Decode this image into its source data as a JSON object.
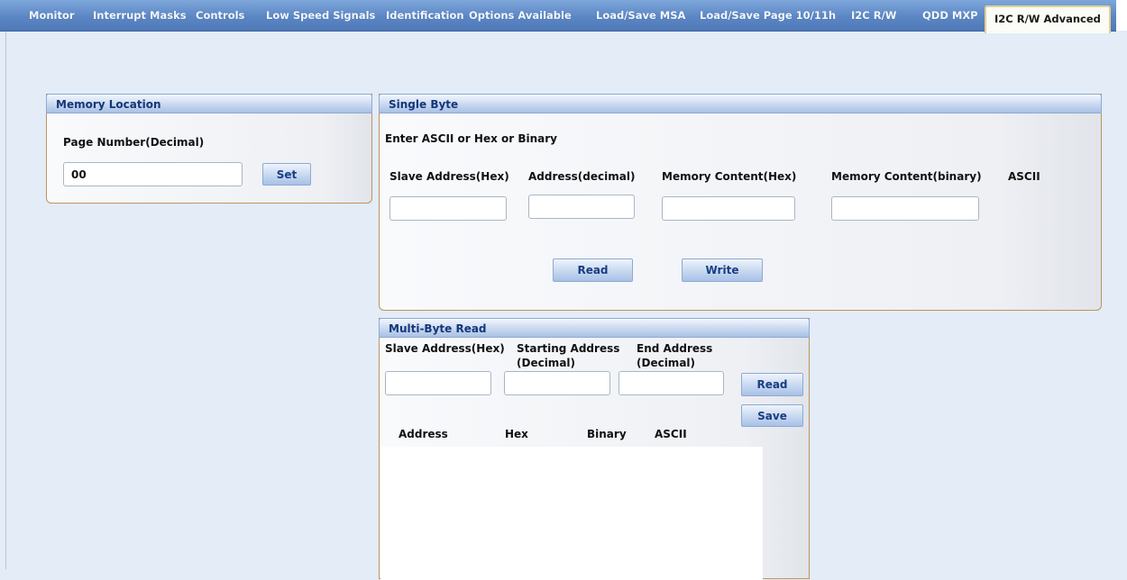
{
  "tabs": [
    {
      "label": "Monitor"
    },
    {
      "label": "Interrupt Masks"
    },
    {
      "label": "Controls"
    },
    {
      "label": "Low Speed Signals"
    },
    {
      "label": "Identification"
    },
    {
      "label": "Options Available"
    },
    {
      "label": "Load/Save MSA"
    },
    {
      "label": "Load/Save Page 10/11h"
    },
    {
      "label": "I2C R/W"
    },
    {
      "label": "QDD MXP"
    },
    {
      "label": "I2C R/W Advanced",
      "active": true
    }
  ],
  "memory_location": {
    "title": "Memory Location",
    "page_label": "Page Number(Decimal)",
    "page_value": "00",
    "set_label": "Set"
  },
  "single_byte": {
    "title": "Single Byte",
    "hint": "Enter ASCII or Hex or Binary",
    "slave_label": "Slave Address(Hex)",
    "address_label": "Address(decimal)",
    "content_hex_label": "Memory Content(Hex)",
    "content_bin_label": "Memory Content(binary)",
    "ascii_label": "ASCII",
    "slave_value": "",
    "address_value": "",
    "content_hex_value": "",
    "content_bin_value": "",
    "read_label": "Read",
    "write_label": "Write"
  },
  "multi_byte": {
    "title": "Multi-Byte Read",
    "slave_label": "Slave Address(Hex)",
    "start_label_1": "Starting Address",
    "start_label_2": "(Decimal)",
    "end_label_1": "End Address",
    "end_label_2": "(Decimal)",
    "slave_value": "",
    "start_value": "",
    "end_value": "",
    "read_label": "Read",
    "save_label": "Save",
    "columns": [
      "Address",
      "Hex",
      "Binary",
      "ASCII"
    ]
  }
}
